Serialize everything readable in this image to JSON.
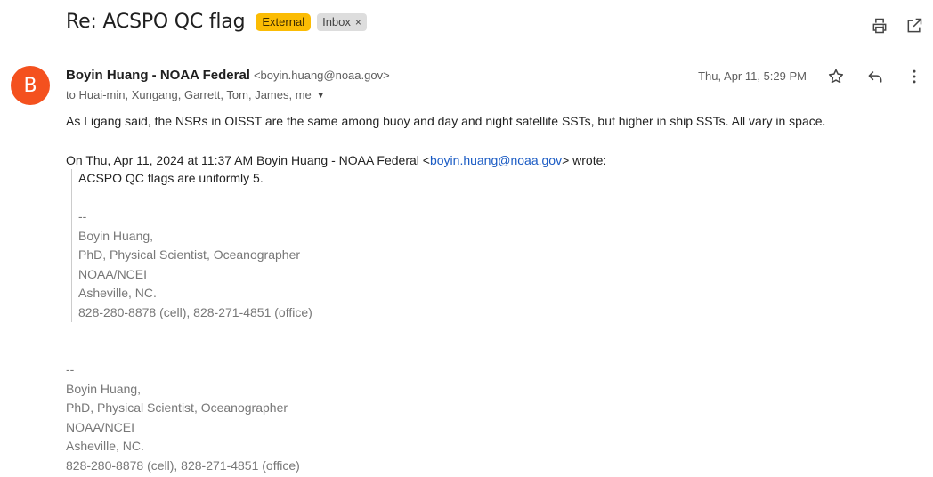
{
  "header": {
    "subject": "Re: ACSPO QC flag",
    "external_label": "External",
    "inbox_label": "Inbox",
    "inbox_remove": "×",
    "colors": {
      "external_bg": "#fbbc04",
      "inbox_bg": "#dddddd",
      "avatar_bg": "#f4511e",
      "link": "#1a5bc4"
    },
    "icons": [
      "print-icon",
      "open-in-new-icon"
    ]
  },
  "message": {
    "avatar_letter": "B",
    "sender_name": "Boyin Huang - NOAA Federal",
    "sender_email": "<boyin.huang@noaa.gov>",
    "recipients": "to Huai-min, Xungang, Garrett, Tom, James, me",
    "date": "Thu, Apr 11, 5:29 PM",
    "icons": [
      "star-icon",
      "reply-icon",
      "more-vert-icon"
    ],
    "body": "As Ligang said, the NSRs in OISST are the same among buoy and day and night satellite SSTs, but higher in ship SSTs. All vary in space.",
    "quote_header": {
      "prefix": "On Thu, Apr 11, 2024 at 11:37 AM Boyin Huang - NOAA Federal <",
      "link": "boyin.huang@noaa.gov",
      "suffix": "> wrote:"
    },
    "quote_body": "ACSPO QC flags are uniformly 5.",
    "quote_signature": {
      "dashes": "--",
      "name": "Boyin Huang,",
      "title": "PhD, Physical Scientist, Oceanographer",
      "org": "NOAA/NCEI",
      "city": "Asheville, NC.",
      "phone": "828-280-8878 (cell), 828-271-4851 (office)"
    },
    "signature": {
      "dashes": "--",
      "name": "Boyin Huang,",
      "title": "PhD, Physical Scientist, Oceanographer",
      "org": "NOAA/NCEI",
      "city": "Asheville, NC.",
      "phone": "828-280-8878 (cell), 828-271-4851 (office)"
    }
  }
}
